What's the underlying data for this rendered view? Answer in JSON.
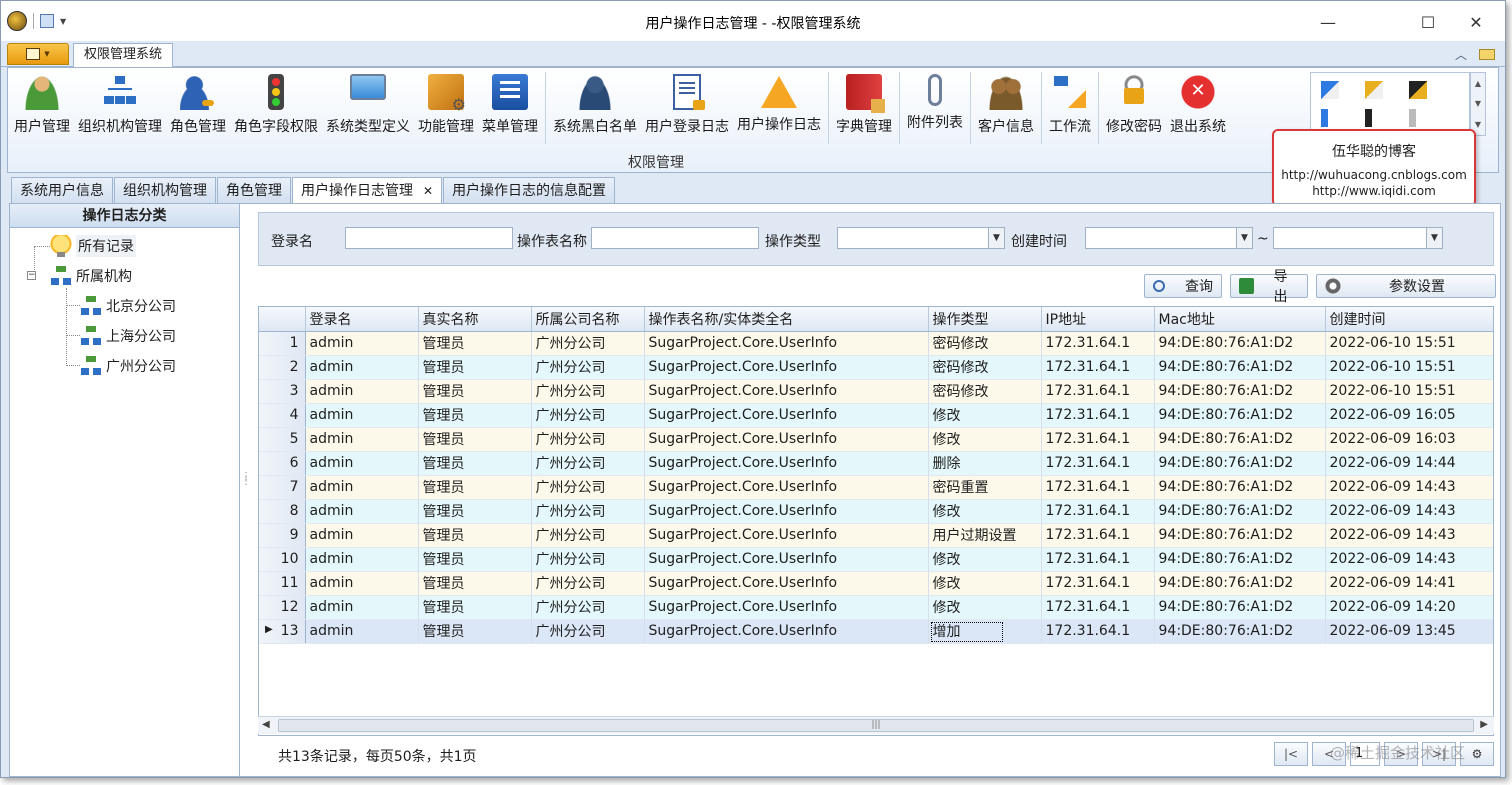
{
  "window": {
    "title": "用户操作日志管理 - -权限管理系统",
    "minimize_glyph": "—",
    "maximize_glyph": "☐",
    "close_glyph": "✕"
  },
  "ribbon": {
    "tab": "权限管理系统",
    "group_label": "权限管理",
    "buttons": [
      {
        "label": "用户管理",
        "icon": "user-icon"
      },
      {
        "label": "组织机构管理",
        "icon": "org-icon"
      },
      {
        "label": "角色管理",
        "icon": "role-icon"
      },
      {
        "label": "角色字段权限",
        "icon": "traffic-light-icon"
      },
      {
        "label": "系统类型定义",
        "icon": "monitor-icon"
      },
      {
        "label": "功能管理",
        "icon": "function-icon"
      },
      {
        "label": "菜单管理",
        "icon": "menu-icon"
      },
      {
        "label": "系统黑白名单",
        "icon": "blacklist-icon"
      },
      {
        "label": "用户登录日志",
        "icon": "login-log-icon"
      },
      {
        "label": "用户操作日志",
        "icon": "warning-icon"
      },
      {
        "label": "字典管理",
        "icon": "dictionary-icon"
      },
      {
        "label": "附件列表",
        "icon": "paperclip-icon"
      },
      {
        "label": "客户信息",
        "icon": "customer-icon"
      },
      {
        "label": "工作流",
        "icon": "workflow-icon"
      },
      {
        "label": "修改密码",
        "icon": "lock-icon"
      },
      {
        "label": "退出系统",
        "icon": "exit-icon"
      }
    ]
  },
  "callout": {
    "title": "伍华聪的博客",
    "line1": "http://wuhuacong.cnblogs.com",
    "line2": "http://www.iqidi.com"
  },
  "doc_tabs": [
    "系统用户信息",
    "组织机构管理",
    "角色管理",
    "用户操作日志管理",
    "用户操作日志的信息配置"
  ],
  "doc_tab_close": "✕",
  "tree": {
    "header": "操作日志分类",
    "nodes": {
      "all": "所有记录",
      "org": "所属机构",
      "beijing": "北京分公司",
      "shanghai": "上海分公司",
      "guangzhou": "广州分公司"
    }
  },
  "filter": {
    "login_label": "登录名",
    "table_label": "操作表名称",
    "optype_label": "操作类型",
    "created_label": "创建时间",
    "range_sep": "~"
  },
  "actions": {
    "query": "查询",
    "export": "导出",
    "settings": "参数设置"
  },
  "grid": {
    "columns": [
      "登录名",
      "真实名称",
      "所属公司名称",
      "操作表名称/实体类全名",
      "操作类型",
      "IP地址",
      "Mac地址",
      "创建时间"
    ],
    "rows": [
      {
        "n": "1",
        "login": "admin",
        "name": "管理员",
        "company": "广州分公司",
        "table": "SugarProject.Core.UserInfo",
        "op": "密码修改",
        "ip": "172.31.64.1",
        "mac": "94:DE:80:76:A1:D2",
        "time": "2022-06-10 15:51"
      },
      {
        "n": "2",
        "login": "admin",
        "name": "管理员",
        "company": "广州分公司",
        "table": "SugarProject.Core.UserInfo",
        "op": "密码修改",
        "ip": "172.31.64.1",
        "mac": "94:DE:80:76:A1:D2",
        "time": "2022-06-10 15:51"
      },
      {
        "n": "3",
        "login": "admin",
        "name": "管理员",
        "company": "广州分公司",
        "table": "SugarProject.Core.UserInfo",
        "op": "密码修改",
        "ip": "172.31.64.1",
        "mac": "94:DE:80:76:A1:D2",
        "time": "2022-06-10 15:51"
      },
      {
        "n": "4",
        "login": "admin",
        "name": "管理员",
        "company": "广州分公司",
        "table": "SugarProject.Core.UserInfo",
        "op": "修改",
        "ip": "172.31.64.1",
        "mac": "94:DE:80:76:A1:D2",
        "time": "2022-06-09 16:05"
      },
      {
        "n": "5",
        "login": "admin",
        "name": "管理员",
        "company": "广州分公司",
        "table": "SugarProject.Core.UserInfo",
        "op": "修改",
        "ip": "172.31.64.1",
        "mac": "94:DE:80:76:A1:D2",
        "time": "2022-06-09 16:03"
      },
      {
        "n": "6",
        "login": "admin",
        "name": "管理员",
        "company": "广州分公司",
        "table": "SugarProject.Core.UserInfo",
        "op": "删除",
        "ip": "172.31.64.1",
        "mac": "94:DE:80:76:A1:D2",
        "time": "2022-06-09 14:44"
      },
      {
        "n": "7",
        "login": "admin",
        "name": "管理员",
        "company": "广州分公司",
        "table": "SugarProject.Core.UserInfo",
        "op": "密码重置",
        "ip": "172.31.64.1",
        "mac": "94:DE:80:76:A1:D2",
        "time": "2022-06-09 14:43"
      },
      {
        "n": "8",
        "login": "admin",
        "name": "管理员",
        "company": "广州分公司",
        "table": "SugarProject.Core.UserInfo",
        "op": "修改",
        "ip": "172.31.64.1",
        "mac": "94:DE:80:76:A1:D2",
        "time": "2022-06-09 14:43"
      },
      {
        "n": "9",
        "login": "admin",
        "name": "管理员",
        "company": "广州分公司",
        "table": "SugarProject.Core.UserInfo",
        "op": "用户过期设置",
        "ip": "172.31.64.1",
        "mac": "94:DE:80:76:A1:D2",
        "time": "2022-06-09 14:43"
      },
      {
        "n": "10",
        "login": "admin",
        "name": "管理员",
        "company": "广州分公司",
        "table": "SugarProject.Core.UserInfo",
        "op": "修改",
        "ip": "172.31.64.1",
        "mac": "94:DE:80:76:A1:D2",
        "time": "2022-06-09 14:43"
      },
      {
        "n": "11",
        "login": "admin",
        "name": "管理员",
        "company": "广州分公司",
        "table": "SugarProject.Core.UserInfo",
        "op": "修改",
        "ip": "172.31.64.1",
        "mac": "94:DE:80:76:A1:D2",
        "time": "2022-06-09 14:41"
      },
      {
        "n": "12",
        "login": "admin",
        "name": "管理员",
        "company": "广州分公司",
        "table": "SugarProject.Core.UserInfo",
        "op": "修改",
        "ip": "172.31.64.1",
        "mac": "94:DE:80:76:A1:D2",
        "time": "2022-06-09 14:20"
      },
      {
        "n": "13",
        "login": "admin",
        "name": "管理员",
        "company": "广州分公司",
        "table": "SugarProject.Core.UserInfo",
        "op": "增加",
        "ip": "172.31.64.1",
        "mac": "94:DE:80:76:A1:D2",
        "time": "2022-06-09 13:45"
      }
    ]
  },
  "pager": {
    "summary": "共13条记录，每页50条，共1页",
    "current_page": "1",
    "first": "|<",
    "prev": "<",
    "next": ">",
    "last": ">|"
  },
  "watermark": "@稀土掘金技术社区",
  "colors": {
    "accent": "#f9c54a",
    "row_odd": "#fdf9ea",
    "row_even": "#e4f7fb",
    "callout_border": "#d9383a"
  }
}
